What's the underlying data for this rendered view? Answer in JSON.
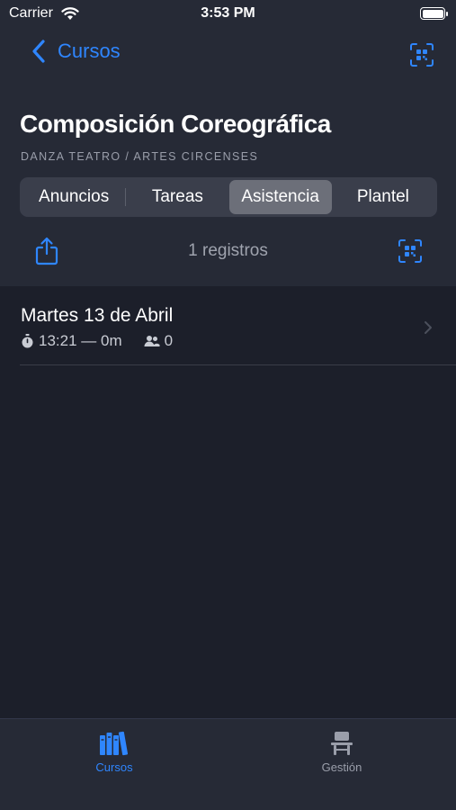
{
  "status_bar": {
    "carrier": "Carrier",
    "time": "3:53 PM"
  },
  "nav": {
    "back_label": "Cursos"
  },
  "course": {
    "title": "Composición Coreográfica",
    "subtitle": "DANZA TEATRO / ARTES CIRCENSES"
  },
  "segments": {
    "items": [
      {
        "label": "Anuncios",
        "selected": false
      },
      {
        "label": "Tareas",
        "selected": false
      },
      {
        "label": "Asistencia",
        "selected": true
      },
      {
        "label": "Plantel",
        "selected": false
      }
    ]
  },
  "toolbar": {
    "records_count": "1 registros"
  },
  "attendance": {
    "rows": [
      {
        "title": "Martes 13 de Abril",
        "time_range": "13:21 — 0m",
        "attendees": "0"
      }
    ]
  },
  "tab_bar": {
    "tabs": [
      {
        "label": "Cursos",
        "icon": "books-icon",
        "active": true
      },
      {
        "label": "Gestión",
        "icon": "school-desk-icon",
        "active": false
      }
    ]
  },
  "colors": {
    "accent": "#2f86ff",
    "background": "#1c1f2a",
    "header_background": "#262a36",
    "segment_selected": "#6c6f79"
  }
}
